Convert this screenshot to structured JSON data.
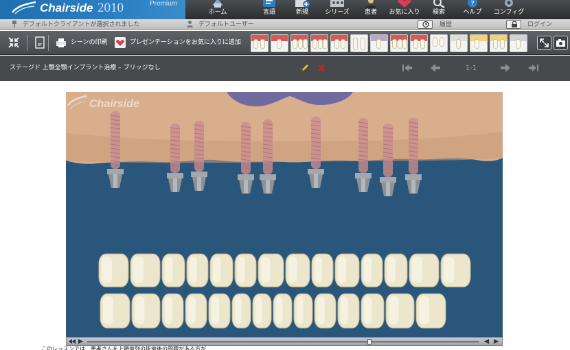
{
  "app": {
    "logo_name": "Chairside",
    "logo_year": "2010",
    "logo_edition": "Premium"
  },
  "nav": [
    {
      "label": "ホーム",
      "icon": "home-icon"
    },
    {
      "label": "言語",
      "icon": "language-icon"
    },
    {
      "label": "新規",
      "icon": "new-icon"
    },
    {
      "label": "シリーズ",
      "icon": "series-icon"
    },
    {
      "label": "患者",
      "icon": "patient-icon"
    },
    {
      "label": "お気に入り",
      "icon": "favorites-icon"
    },
    {
      "label": "検索",
      "icon": "search-icon"
    },
    {
      "label": "ヘルプ",
      "icon": "help-icon"
    },
    {
      "label": "コンフィグ",
      "icon": "config-icon"
    }
  ],
  "status": {
    "client_text": "デフォルトクライアントが選択されました",
    "user_text": "デフォルトユーザー",
    "history_label": "履歴",
    "login_label": "ログイン"
  },
  "toolbar": {
    "print_label": "シーンの印刷",
    "add_favorite_label": "プレゼンテーションをお気に入りに追加"
  },
  "scene": {
    "title": "ステージド 上顎全顎インプラント治療 – ブリッジなし",
    "page": "1-1"
  },
  "viewer": {
    "watermark": "Chairside",
    "caption": "このレッスンでは、患者さんを上顎歯列の抜歯後の問題がある方が…"
  },
  "colors": {
    "header_blue": "#2a7fc2",
    "viewer_bg": "#2a567b",
    "gum": "#d9ae8c",
    "tongue": "#6f6aa0",
    "tooth": "#ece7cc",
    "edit_yellow": "#f2c21b",
    "close_red": "#d42020"
  }
}
